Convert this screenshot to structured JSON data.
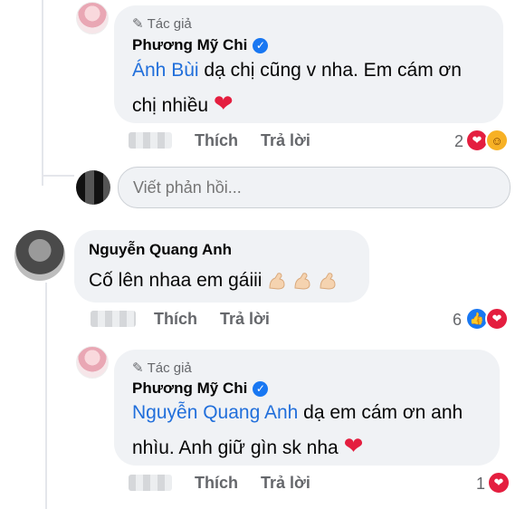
{
  "comments": [
    {
      "author_tag": "Tác giả",
      "name": "Phương Mỹ Chi",
      "mention": "Ánh Bùi",
      "text_line1": " dạ chị cũng v nha. Em cám ơn",
      "text_line2": "chị nhiều",
      "actions": {
        "like": "Thích",
        "reply": "Trả lời"
      },
      "reaction_count": "2"
    },
    {
      "name": "Nguyễn Quang Anh",
      "text": "Cố lên nhaa em gáiii",
      "actions": {
        "like": "Thích",
        "reply": "Trả lời"
      },
      "reaction_count": "6"
    },
    {
      "author_tag": "Tác giả",
      "name": "Phương Mỹ Chi",
      "mention": "Nguyễn Quang Anh",
      "text_line1": " dạ em cám ơn anh",
      "text_line2": "nhìu. Anh giữ gìn sk nha",
      "actions": {
        "like": "Thích",
        "reply": "Trả lời"
      },
      "reaction_count": "1"
    }
  ],
  "reply_box": {
    "placeholder": "Viết phản hồi..."
  },
  "colors": {
    "link": "#216fdb",
    "heart": "#e41e3f",
    "like_blue": "#1877f2"
  }
}
